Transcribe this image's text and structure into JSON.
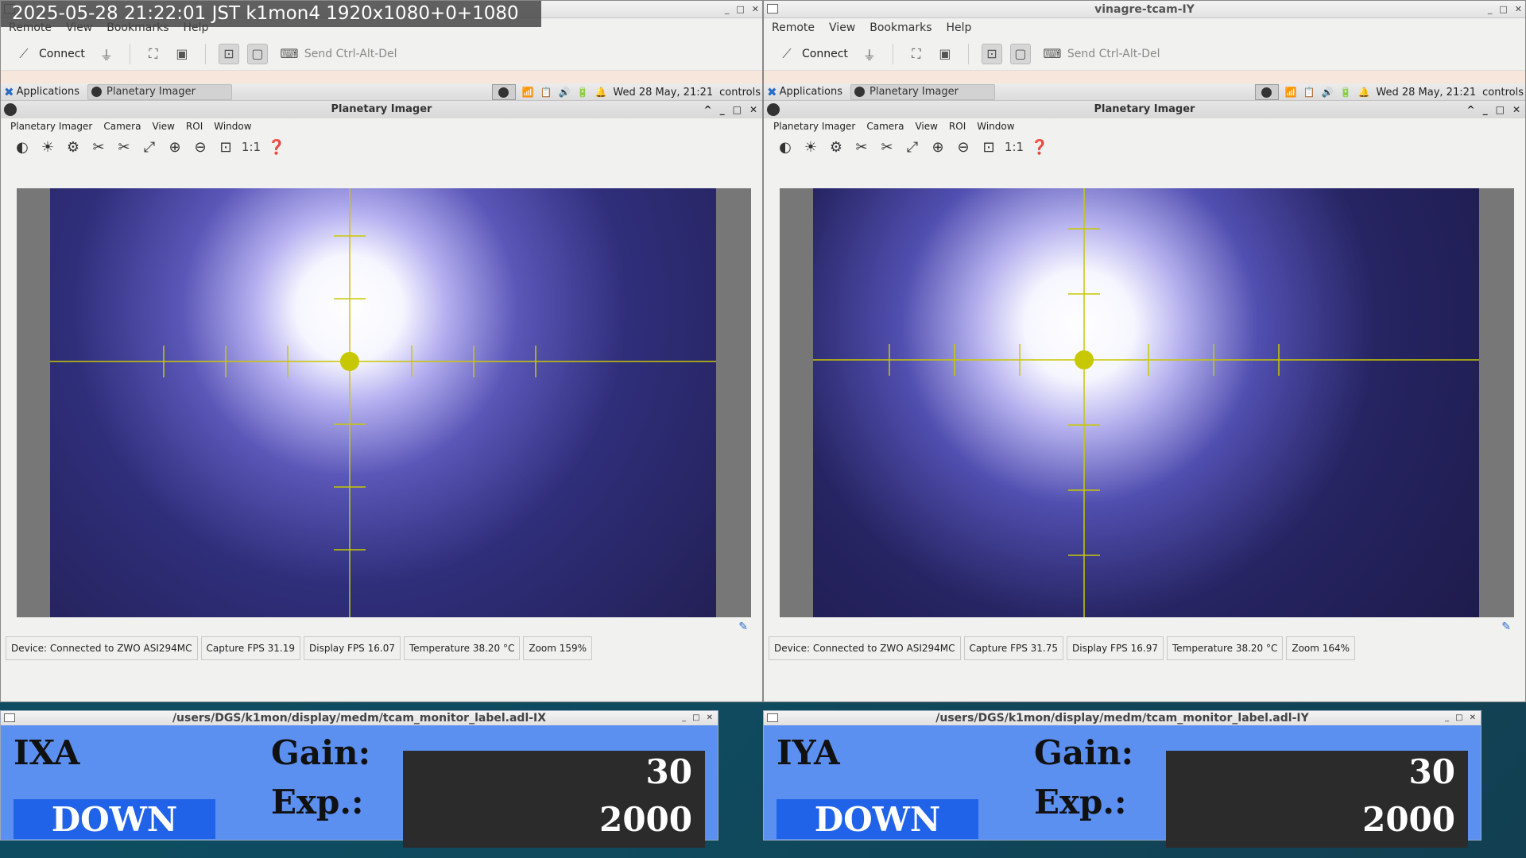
{
  "overlay_text": "2025-05-28 21:22:01 JST k1mon4 1920x1080+0+1080",
  "windows": [
    {
      "title": "",
      "menu": [
        "Remote",
        "View",
        "Bookmarks",
        "Help"
      ],
      "toolbar": {
        "connect": "Connect",
        "send_cad": "Send Ctrl-Alt-Del"
      },
      "panel": {
        "applications": "Applications",
        "task": "Planetary Imager",
        "clock": "Wed 28 May, 21:21",
        "controls": "controls"
      },
      "app": {
        "title": "Planetary Imager",
        "menu": [
          "Planetary Imager",
          "Camera",
          "View",
          "ROI",
          "Window"
        ],
        "zoom_1to1": "1:1"
      },
      "status": {
        "device": "Device: Connected to ZWO ASI294MC",
        "capture_fps": "Capture FPS 31.19",
        "display_fps": "Display FPS 16.07",
        "temperature": "Temperature  38.20 °C",
        "zoom": "Zoom  159%"
      }
    },
    {
      "title": "vinagre-tcam-IY",
      "menu": [
        "Remote",
        "View",
        "Bookmarks",
        "Help"
      ],
      "toolbar": {
        "connect": "Connect",
        "send_cad": "Send Ctrl-Alt-Del"
      },
      "panel": {
        "applications": "Applications",
        "task": "Planetary Imager",
        "clock": "Wed 28 May, 21:21",
        "controls": "controls"
      },
      "app": {
        "title": "Planetary Imager",
        "menu": [
          "Planetary Imager",
          "Camera",
          "View",
          "ROI",
          "Window"
        ],
        "zoom_1to1": "1:1"
      },
      "status": {
        "device": "Device: Connected to ZWO ASI294MC",
        "capture_fps": "Capture FPS 31.75",
        "display_fps": "Display FPS 16.97",
        "temperature": "Temperature  38.20 °C",
        "zoom": "Zoom  164%"
      }
    }
  ],
  "medm": [
    {
      "title": "/users/DGS/k1mon/display/medm/tcam_monitor_label.adl-IX",
      "name": "IXA",
      "state": "DOWN",
      "gain_label": "Gain:",
      "exp_label": "Exp.:",
      "gain": "30",
      "exp": "2000"
    },
    {
      "title": "/users/DGS/k1mon/display/medm/tcam_monitor_label.adl-IY",
      "name": "IYA",
      "state": "DOWN",
      "gain_label": "Gain:",
      "exp_label": "Exp.:",
      "gain": "30",
      "exp": "2000"
    }
  ],
  "colors": {
    "crosshair": "#c8c800",
    "state_bg": "#2063e8",
    "medm_bg": "#5b8ff0"
  }
}
